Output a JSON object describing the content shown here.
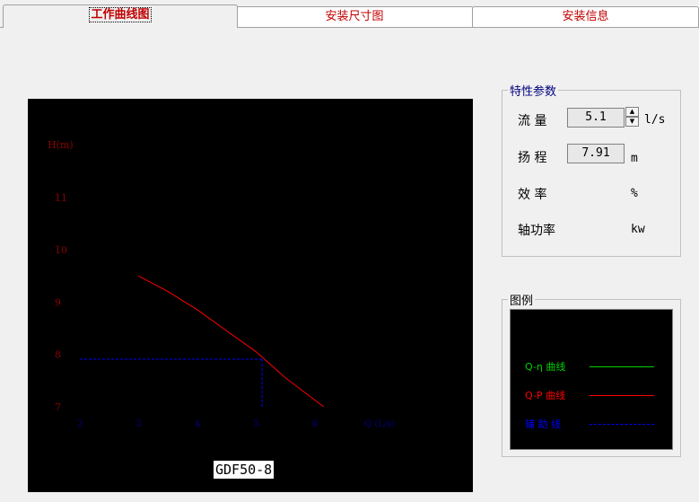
{
  "tabs": [
    {
      "label": "工作曲线图",
      "active": true
    },
    {
      "label": "安装尺寸图",
      "active": false
    },
    {
      "label": "安装信息",
      "active": false
    }
  ],
  "chart": {
    "model": "GDF50-8",
    "y_axis_label": "H(m)",
    "x_axis_label": "Q (L/s)"
  },
  "chart_data": {
    "type": "line",
    "xlabel": "Q (L/s)",
    "ylabel": "H(m)",
    "x_ticks": [
      2,
      3,
      4,
      5,
      6
    ],
    "y_ticks": [
      7,
      8,
      9,
      10,
      11
    ],
    "xlim": [
      2,
      7
    ],
    "ylim": [
      7,
      11.5
    ],
    "series": [
      {
        "name": "Q-P 曲线",
        "color": "#ff0000",
        "points": [
          [
            3.0,
            9.5
          ],
          [
            3.5,
            9.2
          ],
          [
            4.0,
            8.85
          ],
          [
            4.5,
            8.45
          ],
          [
            5.0,
            8.05
          ],
          [
            5.5,
            7.55
          ],
          [
            6.15,
            7.0
          ]
        ]
      }
    ],
    "guide": {
      "x": 5.1,
      "y": 7.91,
      "color": "#0000ff",
      "style": "dashed"
    }
  },
  "params": {
    "title": "特性参数",
    "flow_label": "流  量",
    "flow_value": "5.1",
    "flow_unit": "l/s",
    "head_label": "扬  程",
    "head_value": "7.91",
    "head_unit": "m",
    "efficiency_label": "效  率",
    "efficiency_unit": "%",
    "shaft_power_label": "轴功率",
    "shaft_power_unit": "kw"
  },
  "legend": {
    "title": "图例",
    "items": [
      {
        "label": "Q-η 曲线",
        "color": "#00d000",
        "style": "solid"
      },
      {
        "label": "Q-P 曲线",
        "color": "#ff0000",
        "style": "solid"
      },
      {
        "label": "辅 助 线",
        "color": "#0000ff",
        "style": "dashed"
      }
    ]
  }
}
